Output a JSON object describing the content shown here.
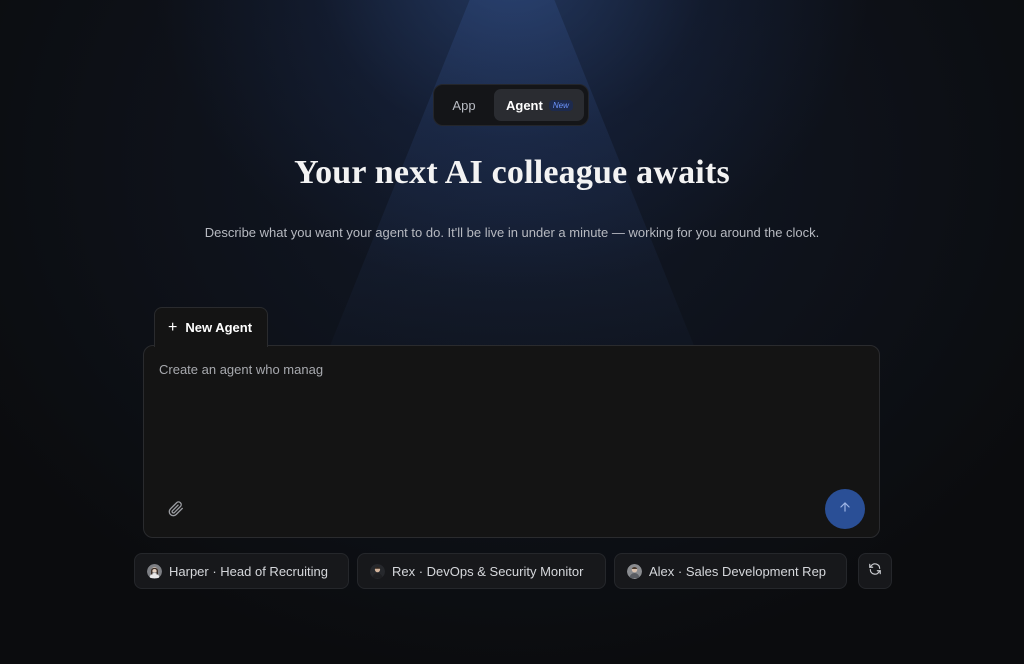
{
  "mode_toggle": {
    "options": [
      {
        "label": "App",
        "selected": false
      },
      {
        "label": "Agent",
        "selected": true,
        "badge": "New"
      }
    ]
  },
  "hero": {
    "title": "Your next AI colleague awaits",
    "subtitle": "Describe what you want your agent to do. It'll be live in under a minute — working for you around the clock."
  },
  "composer": {
    "tab_label": "New Agent",
    "input_value": "Create an agent who manag",
    "attach_icon": "paperclip-icon",
    "send_icon": "arrow-up-icon",
    "send_color": "#2a4f96"
  },
  "suggestions": [
    {
      "label": "Harper · Head of Recruiting",
      "avatar": "avatar-harper"
    },
    {
      "label": "Rex · DevOps & Security Monitor",
      "avatar": "avatar-rex"
    },
    {
      "label": "Alex · Sales Development Rep",
      "avatar": "avatar-alex"
    }
  ],
  "refresh_icon": "refresh-icon",
  "colors": {
    "background": "#0b0c0e",
    "accent": "#2a4f96",
    "badge_text": "#6d95ff"
  }
}
